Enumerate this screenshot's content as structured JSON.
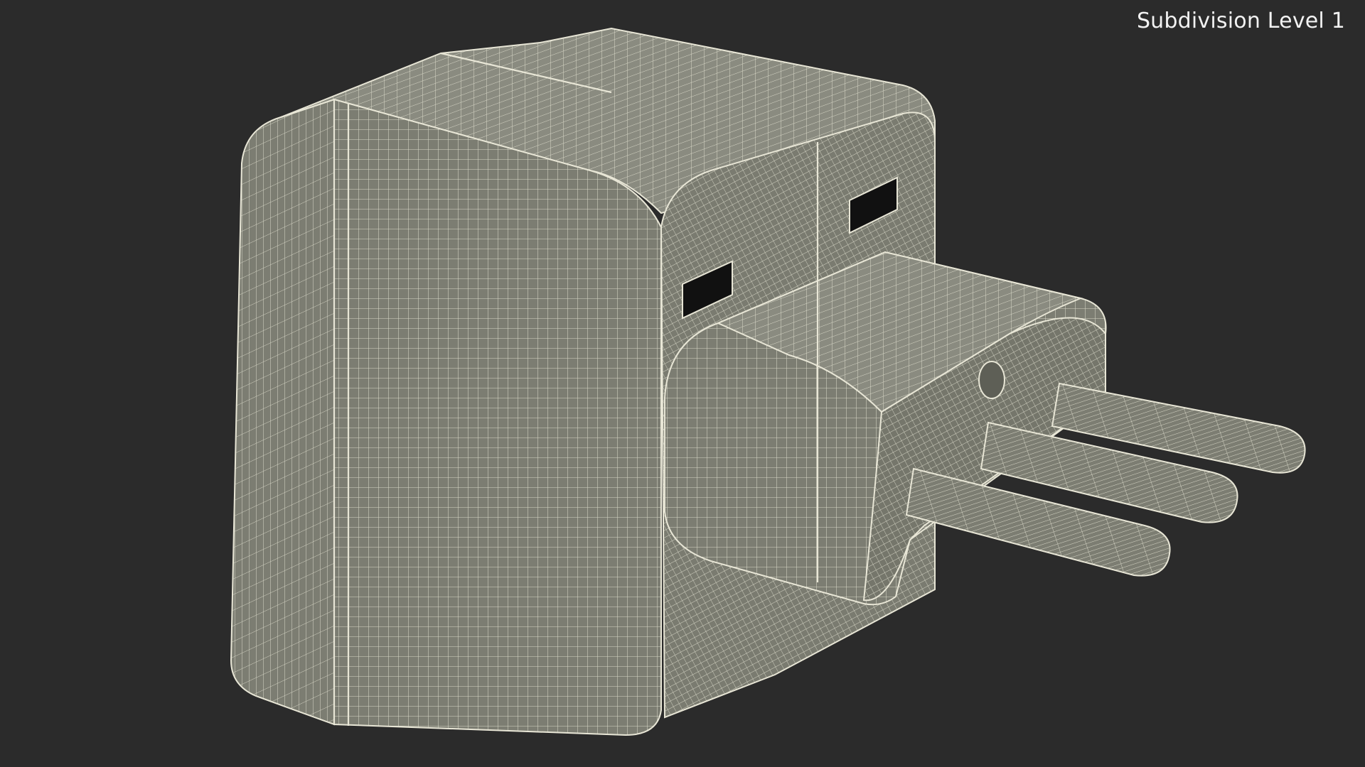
{
  "viewport": {
    "label": "Subdivision Level 1",
    "subject": "plug-adapter-wireframe"
  },
  "colors": {
    "background": "#2b2b2b",
    "surface": "#7c7d72",
    "surface_light": "#8a8b80",
    "surface_dark": "#6a6b61",
    "wire": "#e8e6d6",
    "slot": "#111111"
  }
}
